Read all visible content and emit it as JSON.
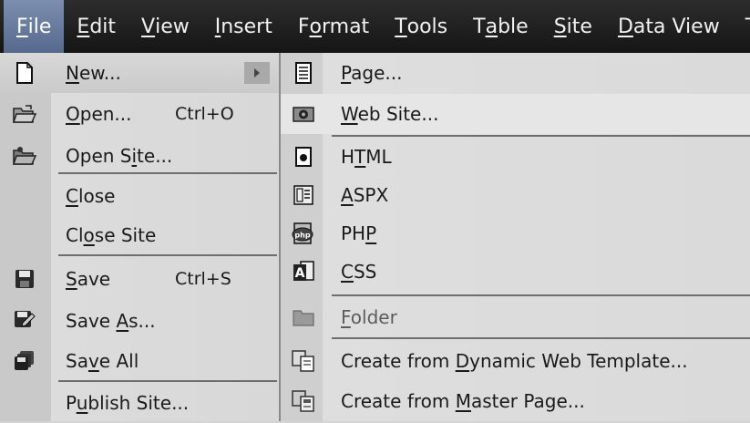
{
  "menubar": {
    "items": [
      {
        "pre": "",
        "acc": "F",
        "post": "ile"
      },
      {
        "pre": "",
        "acc": "E",
        "post": "dit"
      },
      {
        "pre": "",
        "acc": "V",
        "post": "iew"
      },
      {
        "pre": "",
        "acc": "I",
        "post": "nsert"
      },
      {
        "pre": "F",
        "acc": "o",
        "post": "rmat"
      },
      {
        "pre": "",
        "acc": "T",
        "post": "ools"
      },
      {
        "pre": "T",
        "acc": "a",
        "post": "ble"
      },
      {
        "pre": "",
        "acc": "S",
        "post": "ite"
      },
      {
        "pre": "",
        "acc": "D",
        "post": "ata View"
      },
      {
        "pre": "Ta",
        "acc": "",
        "post": ""
      }
    ]
  },
  "file_menu": {
    "items": [
      {
        "pre": "",
        "acc": "N",
        "post": "ew...",
        "shortcut": "",
        "icon": "new-document-icon"
      },
      {
        "pre": "",
        "acc": "O",
        "post": "pen...",
        "shortcut": "Ctrl+O",
        "icon": "open-folder-icon"
      },
      {
        "pre": "Open S",
        "acc": "i",
        "post": "te...",
        "shortcut": "",
        "icon": "open-site-icon"
      },
      {
        "pre": "",
        "acc": "C",
        "post": "lose",
        "shortcut": "",
        "icon": ""
      },
      {
        "pre": "Cl",
        "acc": "o",
        "post": "se Site",
        "shortcut": "",
        "icon": ""
      },
      {
        "pre": "",
        "acc": "S",
        "post": "ave",
        "shortcut": "Ctrl+S",
        "icon": "save-icon"
      },
      {
        "pre": "Save ",
        "acc": "A",
        "post": "s...",
        "shortcut": "",
        "icon": "save-as-icon"
      },
      {
        "pre": "Sa",
        "acc": "v",
        "post": "e All",
        "shortcut": "",
        "icon": "save-all-icon"
      },
      {
        "pre": "P",
        "acc": "u",
        "post": "blish Site...",
        "shortcut": "",
        "icon": ""
      }
    ]
  },
  "new_submenu": {
    "items": [
      {
        "pre": "",
        "acc": "P",
        "post": "age...",
        "icon": "page-icon"
      },
      {
        "pre": "",
        "acc": "W",
        "post": "eb Site...",
        "icon": "web-site-icon"
      },
      {
        "pre": "H",
        "acc": "T",
        "post": "ML",
        "icon": "html-icon"
      },
      {
        "pre": "",
        "acc": "A",
        "post": "SPX",
        "icon": "aspx-icon"
      },
      {
        "pre": "PH",
        "acc": "P",
        "post": "",
        "icon": "php-icon"
      },
      {
        "pre": "",
        "acc": "C",
        "post": "SS",
        "icon": "css-icon"
      },
      {
        "pre": "",
        "acc": "F",
        "post": "older",
        "icon": "folder-icon"
      },
      {
        "pre": "Create from ",
        "acc": "D",
        "post": "ynamic Web Template...",
        "icon": "dynamic-template-icon"
      },
      {
        "pre": "Create from ",
        "acc": "M",
        "post": "aster Page...",
        "icon": "master-page-icon"
      }
    ]
  },
  "colors": {
    "menubar_bg": "#1e1e1e",
    "active_menu": "#6a7ca0",
    "menu_bg": "#d8d8d8"
  }
}
